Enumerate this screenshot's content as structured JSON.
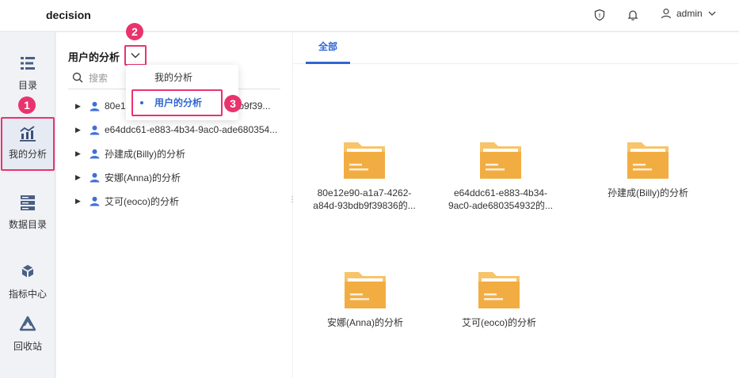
{
  "header": {
    "brand": "decision",
    "username": "admin"
  },
  "leftnav": {
    "items": [
      {
        "label": "目录",
        "icon": "list-icon"
      },
      {
        "label": "我的分析",
        "icon": "analysis-chart-icon",
        "active": true
      },
      {
        "label": "数据目录",
        "icon": "database-icon"
      },
      {
        "label": "指标中心",
        "icon": "indicator-hub-icon"
      },
      {
        "label": "回收站",
        "icon": "recycle-bin-icon"
      }
    ]
  },
  "tree": {
    "title": "用户的分析",
    "search_placeholder": "搜索",
    "rows": [
      {
        "text": "80e12",
        "text_tail": "b9f39..."
      },
      {
        "text": "e64ddc61-e883-4b34-9ac0-ade680354..."
      },
      {
        "text": "孙建成(Billy)的分析"
      },
      {
        "text": "安娜(Anna)的分析"
      },
      {
        "text": "艾可(eoco)的分析"
      }
    ]
  },
  "dropdown": {
    "options": [
      "我的分析",
      "用户的分析"
    ],
    "selected": "用户的分析"
  },
  "badges": [
    "1",
    "2",
    "3"
  ],
  "content": {
    "tabs": [
      "全部"
    ],
    "folders": [
      {
        "line1": "80e12e90-a1a7-4262-",
        "line2": "a84d-93bdb9f39836的..."
      },
      {
        "line1": "e64ddc61-e883-4b34-",
        "line2": "9ac0-ade680354932的..."
      },
      {
        "line1": "孙建成(Billy)的分析",
        "line2": ""
      },
      {
        "line1": "安娜(Anna)的分析",
        "line2": ""
      },
      {
        "line1": "艾可(eoco)的分析",
        "line2": ""
      }
    ]
  },
  "colors": {
    "accent": "#2f66d1",
    "highlight": "#e8336e",
    "folder": "#f5b74e"
  }
}
